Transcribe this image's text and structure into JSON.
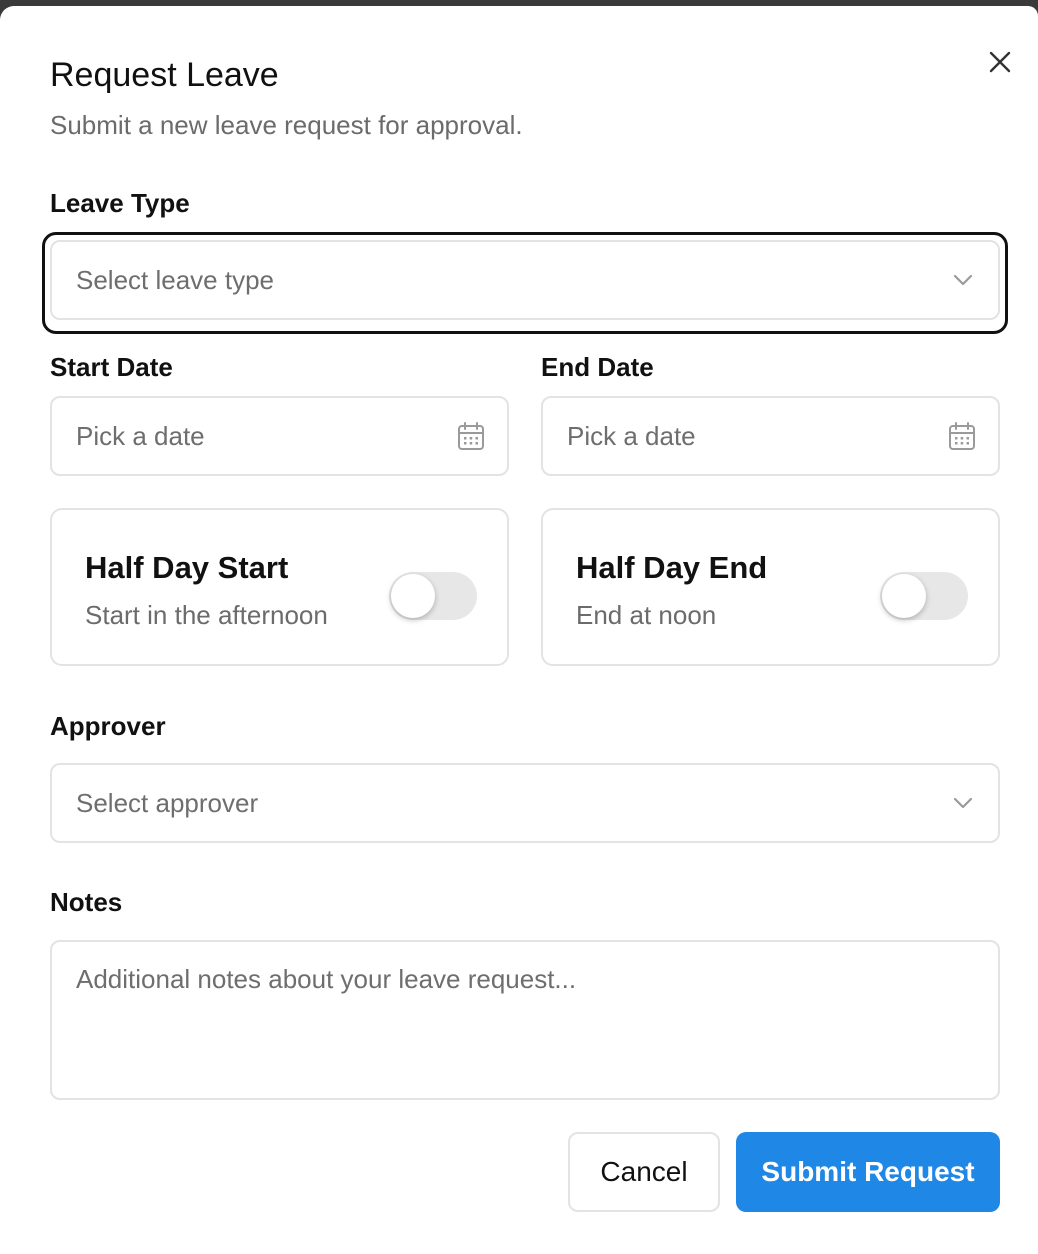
{
  "dialog": {
    "title": "Request Leave",
    "subtitle": "Submit a new leave request for approval."
  },
  "leave_type": {
    "label": "Leave Type",
    "placeholder": "Select leave type"
  },
  "start_date": {
    "label": "Start Date",
    "placeholder": "Pick a date"
  },
  "end_date": {
    "label": "End Date",
    "placeholder": "Pick a date"
  },
  "half_day_start": {
    "title": "Half Day Start",
    "description": "Start in the afternoon",
    "enabled": false
  },
  "half_day_end": {
    "title": "Half Day End",
    "description": "End at noon",
    "enabled": false
  },
  "approver": {
    "label": "Approver",
    "placeholder": "Select approver"
  },
  "notes": {
    "label": "Notes",
    "placeholder": "Additional notes about your leave request..."
  },
  "actions": {
    "cancel_label": "Cancel",
    "submit_label": "Submit Request"
  },
  "colors": {
    "accent": "#1f87e5",
    "toggle_off": "#e7e7e7",
    "border": "#e3e3e3"
  },
  "icons": {
    "close": "close-icon",
    "chevron": "chevron-down-icon",
    "calendar": "calendar-icon"
  }
}
